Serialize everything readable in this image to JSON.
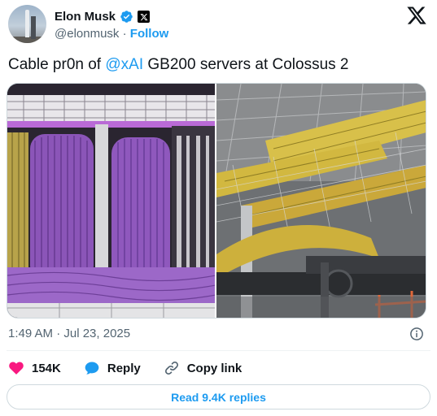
{
  "author": {
    "display_name": "Elon Musk",
    "handle": "@elonmusk",
    "separator": "·",
    "follow_label": "Follow"
  },
  "tweet": {
    "text_before": "Cable pr0n of ",
    "mention": "@xAI",
    "text_after": " GB200 servers at Colossus 2",
    "timestamp": "1:49 AM · Jul 23, 2025"
  },
  "actions": {
    "likes": "154K",
    "reply_label": "Reply",
    "copy_label": "Copy link"
  },
  "read_replies_label": "Read 9.4K replies",
  "colors": {
    "accent": "#1d9bf0",
    "like": "#f91880",
    "text": "#0f1419",
    "secondary": "#536471"
  },
  "icons": [
    "verified-icon",
    "x-badge-icon",
    "x-logo-icon",
    "info-icon",
    "heart-icon",
    "reply-icon",
    "link-icon"
  ]
}
